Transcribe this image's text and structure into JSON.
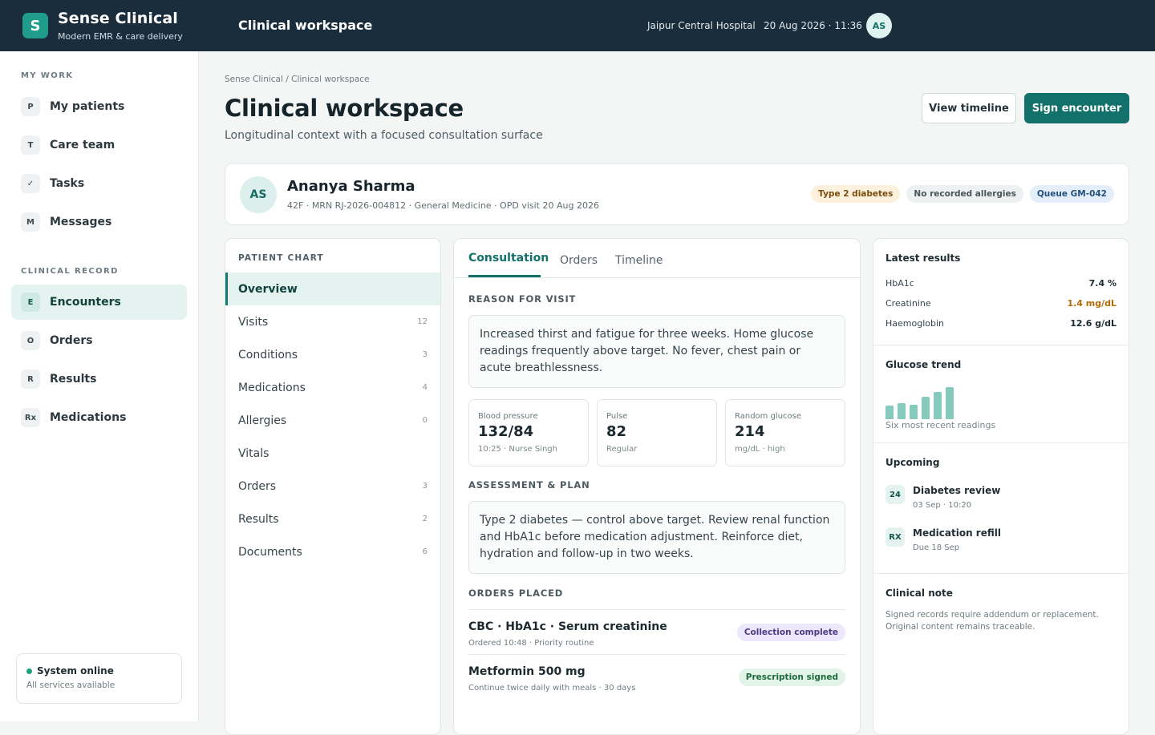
{
  "header": {
    "logo_letter": "S",
    "brand": "Sense Clinical",
    "brand_sub": "Modern EMR & care delivery",
    "workspace": "Clinical workspace",
    "hospital": "Jaipur Central Hospital",
    "datetime": "20 Aug 2026 · 11:36",
    "user_initials": "AS"
  },
  "sidebar": {
    "my_work_label": "MY WORK",
    "my_work": [
      {
        "badge": "P",
        "label": "My patients"
      },
      {
        "badge": "T",
        "label": "Care team"
      },
      {
        "badge": "✓",
        "label": "Tasks"
      },
      {
        "badge": "M",
        "label": "Messages"
      }
    ],
    "clinical_label": "CLINICAL RECORD",
    "clinical": [
      {
        "badge": "E",
        "label": "Encounters",
        "active": true
      },
      {
        "badge": "O",
        "label": "Orders"
      },
      {
        "badge": "R",
        "label": "Results"
      },
      {
        "badge": "Rx",
        "label": "Medications"
      }
    ],
    "system": {
      "title": "System online",
      "sub": "All services available"
    }
  },
  "page": {
    "breadcrumb": "Sense Clinical / Clinical workspace",
    "title": "Clinical workspace",
    "subtitle": "Longitudinal context with a focused consultation surface",
    "view_timeline": "View timeline",
    "sign_encounter": "Sign encounter"
  },
  "patient": {
    "initials": "AS",
    "name": "Ananya Sharma",
    "meta": "42F · MRN RJ-2026-004812 · General Medicine · OPD visit 20 Aug 2026",
    "tags": [
      "Type 2 diabetes",
      "No recorded allergies",
      "Queue GM-042"
    ]
  },
  "chart_nav": {
    "heading": "PATIENT CHART",
    "items": [
      {
        "label": "Overview",
        "count": ""
      },
      {
        "label": "Visits",
        "count": "12"
      },
      {
        "label": "Conditions",
        "count": "3"
      },
      {
        "label": "Medications",
        "count": "4"
      },
      {
        "label": "Allergies",
        "count": "0"
      },
      {
        "label": "Vitals",
        "count": ""
      },
      {
        "label": "Orders",
        "count": "3"
      },
      {
        "label": "Results",
        "count": "2"
      },
      {
        "label": "Documents",
        "count": "6"
      }
    ]
  },
  "consult": {
    "tabs": [
      "Consultation",
      "Orders",
      "Timeline"
    ],
    "reason_label": "REASON FOR VISIT",
    "reason_text": "Increased thirst and fatigue for three weeks. Home glucose readings frequently above target. No fever, chest pain or acute breathlessness.",
    "vitals": [
      {
        "label": "Blood pressure",
        "value": "132/84",
        "sub": "10:25 · Nurse Singh"
      },
      {
        "label": "Pulse",
        "value": "82",
        "sub": "Regular"
      },
      {
        "label": "Random glucose",
        "value": "214",
        "sub": "mg/dL · high"
      }
    ],
    "plan_label": "ASSESSMENT & PLAN",
    "plan_text": "Type 2 diabetes — control above target. Review renal function and HbA1c before medication adjustment. Reinforce diet, hydration and follow-up in two weeks.",
    "orders_label": "ORDERS PLACED",
    "orders": [
      {
        "name": "CBC · HbA1c · Serum creatinine",
        "sub": "Ordered 10:48 · Priority routine",
        "status": "Collection complete"
      },
      {
        "name": "Metformin 500 mg",
        "sub": "Continue twice daily with meals · 30 days",
        "status": "Prescription signed"
      }
    ]
  },
  "right": {
    "results_title": "Latest results",
    "results": [
      {
        "name": "HbA1c",
        "value": "7.4 %"
      },
      {
        "name": "Creatinine",
        "value": "1.4 mg/dL"
      },
      {
        "name": "Haemoglobin",
        "value": "12.6 g/dL"
      }
    ],
    "trend_title": "Glucose trend",
    "trend_caption": "Six most recent readings",
    "trend_levels": [
      0.38,
      0.46,
      0.42,
      0.64,
      0.78,
      0.92
    ],
    "upcoming_title": "Upcoming",
    "upcoming": [
      {
        "badge": "24",
        "title": "Diabetes review",
        "sub": "03 Sep · 10:20"
      },
      {
        "badge": "RX",
        "title": "Medication refill",
        "sub": "Due 18 Sep"
      }
    ],
    "note_title": "Clinical note",
    "note_text": "Signed records require addendum or replacement. Original content remains traceable."
  }
}
